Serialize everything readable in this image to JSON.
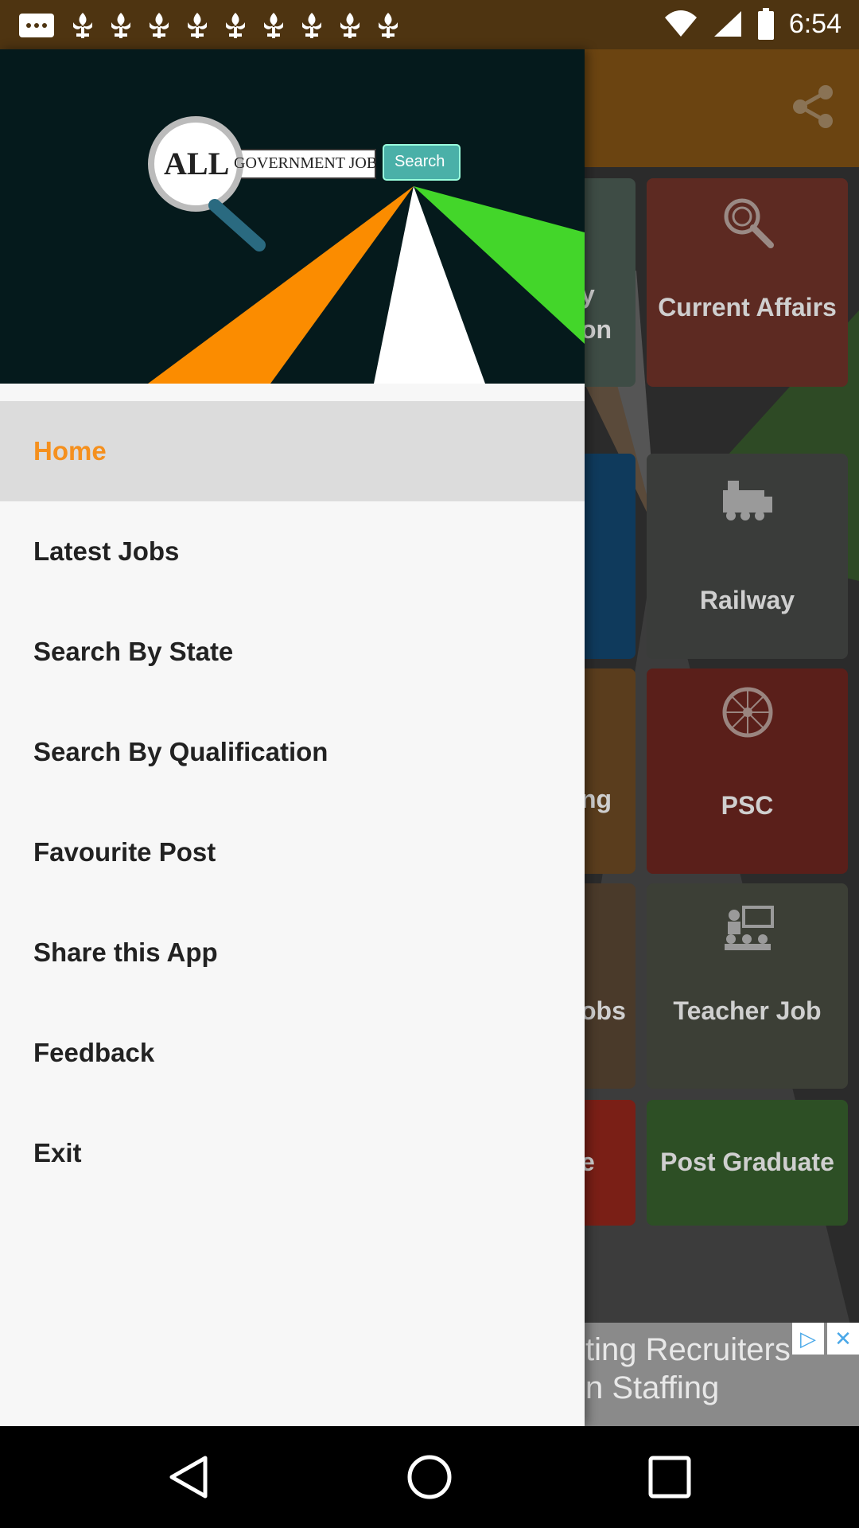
{
  "status_bar": {
    "time": "6:54",
    "notification_icons": [
      "message-icon",
      "flower-icon",
      "flower-icon",
      "flower-icon",
      "flower-icon",
      "flower-icon",
      "flower-icon",
      "flower-icon",
      "flower-icon"
    ]
  },
  "header_logo": {
    "logo_all": "ALL",
    "logo_text": "GOVERNMENT JOB",
    "logo_button": "Search",
    "colors": {
      "saffron": "#fb8c00",
      "white": "#ffffff",
      "green": "#43d62a",
      "background": "#051a1c"
    }
  },
  "drawer": {
    "items": [
      {
        "label": "Home",
        "active": true
      },
      {
        "label": "Latest Jobs"
      },
      {
        "label": "Search By State"
      },
      {
        "label": "Search By Qualification"
      },
      {
        "label": "Favourite Post"
      },
      {
        "label": "Share this App"
      },
      {
        "label": "Feedback"
      },
      {
        "label": "Exit"
      }
    ]
  },
  "background_tiles": {
    "left_column": [
      {
        "label_line1": "y",
        "label_line2": "on",
        "color": "#3e4c45"
      },
      {
        "label": "",
        "color": "#0f3a5c"
      },
      {
        "label": "ng",
        "color": "#5a3d1d"
      },
      {
        "label": "obs",
        "color": "#4a3a2a"
      },
      {
        "label": "e",
        "color": "#7a1f16"
      }
    ],
    "right_column": [
      {
        "label": "Current Affairs",
        "icon": "search-globe-icon",
        "color": "#5d2a22"
      },
      {
        "label": "Railway",
        "icon": "train-icon",
        "color": "#3a3c3a"
      },
      {
        "label": "PSC",
        "icon": "ashoka-chakra-icon",
        "color": "#5a1f1a"
      },
      {
        "label": "Teacher Job",
        "icon": "teacher-icon",
        "color": "#3c3f36"
      },
      {
        "label": "Post Graduate",
        "icon": "",
        "color": "#2d4f25"
      }
    ]
  },
  "ad": {
    "line1": "ting Recruiters",
    "line2": "n Staffing"
  }
}
